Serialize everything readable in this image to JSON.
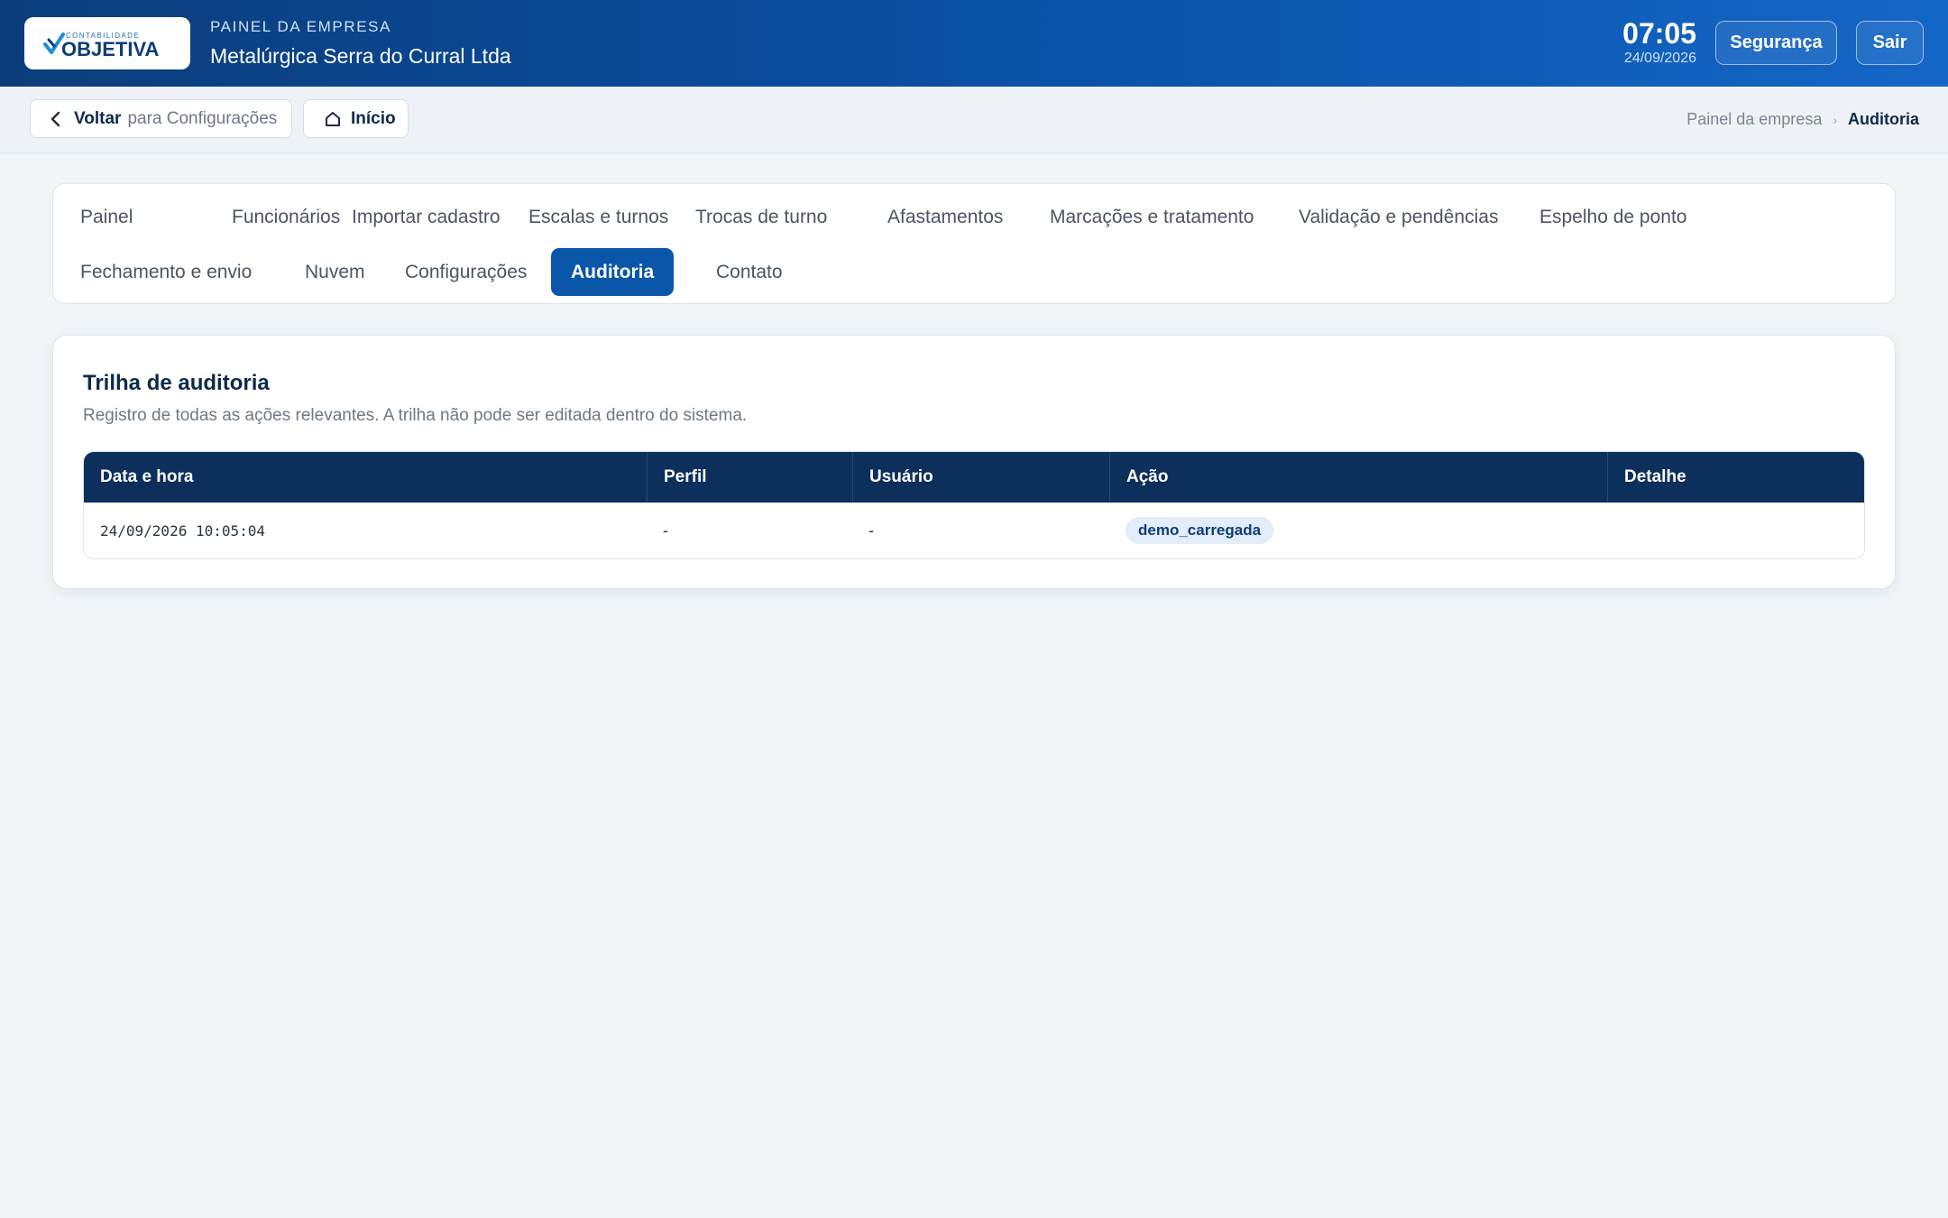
{
  "colors": {
    "header_gradient_start": "#0b3d7a",
    "header_gradient_end": "#1466c6",
    "accent": "#0a56a8",
    "table_header": "#0d2f5c",
    "page_background": "#f1f5f8"
  },
  "header": {
    "logo": {
      "small": "CONTABILIDADE",
      "big": "OBJETIVA"
    },
    "kicker": "PAINEL DA EMPRESA",
    "company_name": "Metalúrgica Serra do Curral Ltda",
    "time": "07:05",
    "date": "24/09/2026",
    "security_label": "Segurança",
    "exit_label": "Sair"
  },
  "subnav": {
    "back_icon": "chevron-left-icon",
    "back_strong": "Voltar",
    "back_muted": "para Configurações",
    "home_icon": "home-icon",
    "home_label": "Início",
    "breadcrumb": [
      "Painel da empresa",
      "Auditoria"
    ]
  },
  "tabs": [
    {
      "label": "Painel"
    },
    {
      "label": "Funcionários"
    },
    {
      "label": "Importar cadastro"
    },
    {
      "label": "Escalas e turnos"
    },
    {
      "label": "Trocas de turno"
    },
    {
      "label": "Afastamentos"
    },
    {
      "label": "Marcações e tratamento"
    },
    {
      "label": "Validação e pendências"
    },
    {
      "label": "Espelho de ponto"
    },
    {
      "label": "Fechamento e envio"
    },
    {
      "label": "Nuvem"
    },
    {
      "label": "Configurações"
    },
    {
      "label": "Auditoria",
      "active": true
    },
    {
      "label": "Contato"
    }
  ],
  "audit": {
    "title": "Trilha de auditoria",
    "subtitle": "Registro de todas as ações relevantes. A trilha não pode ser editada dentro do sistema.",
    "columns": [
      "Data e hora",
      "Perfil",
      "Usuário",
      "Ação",
      "Detalhe"
    ],
    "rows": [
      {
        "datetime": "24/09/2026 10:05:04",
        "perfil": "-",
        "usuario": "-",
        "acao": "demo_carregada",
        "detalhe": ""
      }
    ]
  }
}
